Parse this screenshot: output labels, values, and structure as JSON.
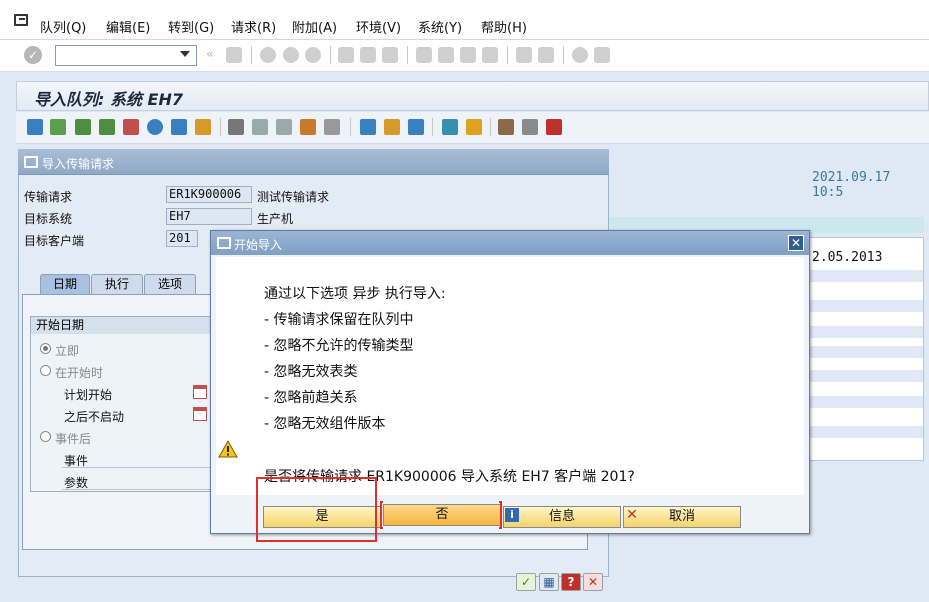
{
  "menubar": {
    "items": [
      "队列(Q)",
      "编辑(E)",
      "转到(G)",
      "请求(R)",
      "附加(A)",
      "环境(V)",
      "系统(Y)",
      "帮助(H)"
    ]
  },
  "toolbar": {
    "command_value": ""
  },
  "page": {
    "title": "导入队列: 系统 EH7"
  },
  "background": {
    "date_right": "2021.09.17 10:5",
    "list_date": "2.05.2013"
  },
  "panel": {
    "title": "导入传输请求",
    "fields": [
      {
        "label": "传输请求",
        "value": "ER1K900006",
        "desc": "测试传输请求"
      },
      {
        "label": "目标系统",
        "value": "EH7",
        "desc": "生产机"
      },
      {
        "label": "目标客户端",
        "value": "201",
        "desc": ""
      }
    ],
    "tabs": [
      "日期",
      "执行",
      "选项"
    ],
    "group_title": "开始日期",
    "options": [
      "立即",
      "在开始时",
      "计划开始",
      "之后不启动",
      "事件后",
      "事件",
      "参数"
    ]
  },
  "dialog": {
    "title": "开始导入",
    "lines": [
      "通过以下选项 异步 执行导入:",
      "- 传输请求保留在队列中",
      "- 忽略不允许的传输类型",
      "- 忽略无效表类",
      "- 忽略前趋关系",
      "- 忽略无效组件版本"
    ],
    "question": "是否将传输请求 ER1K900006 导入系统 EH7 客户端 201?",
    "buttons": {
      "yes": "是",
      "no": "否",
      "info": "信息",
      "cancel": "取消"
    }
  },
  "colors": {
    "accent": "#809fc4",
    "button": "#f5d36a",
    "highlight": "#e0302a"
  }
}
